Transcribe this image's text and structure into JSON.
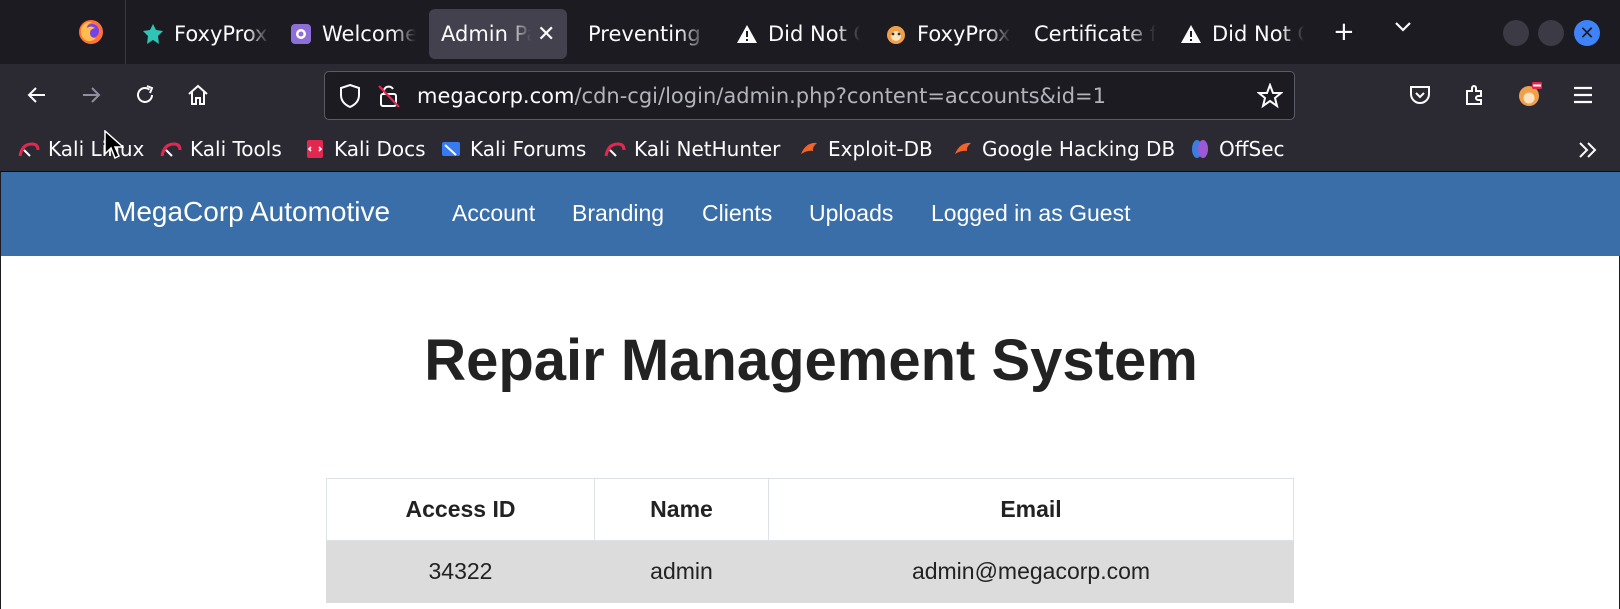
{
  "browser": {
    "tabs": [
      {
        "label": "FoxyProxy",
        "icon": "foxyproxy-icon",
        "active": false
      },
      {
        "label": "Welcome",
        "icon": "tor-icon",
        "active": false
      },
      {
        "label": "Admin Panel",
        "icon": "",
        "active": true
      },
      {
        "label": "Preventing V",
        "icon": "",
        "active": false
      },
      {
        "label": "Did Not Connect",
        "icon": "warning-icon",
        "active": false
      },
      {
        "label": "FoxyProxy",
        "icon": "foxyproxy-cat-icon",
        "active": false
      },
      {
        "label": "Certificate f",
        "icon": "",
        "active": false
      },
      {
        "label": "Did Not Connect",
        "icon": "warning-icon",
        "active": false
      }
    ],
    "new_tab_symbol": "+",
    "list_tabs_symbol": "⌵",
    "url": {
      "host": "megacorp.com",
      "path": "/cdn-cgi/login/admin.php?content=accounts&id=1"
    },
    "bookmarks": [
      {
        "label": "Kali Linux",
        "icon": "kali-icon"
      },
      {
        "label": "Kali Tools",
        "icon": "kali-icon"
      },
      {
        "label": "Kali Docs",
        "icon": "kali-docs-icon"
      },
      {
        "label": "Kali Forums",
        "icon": "kali-forums-icon"
      },
      {
        "label": "Kali NetHunter",
        "icon": "kali-icon"
      },
      {
        "label": "Exploit-DB",
        "icon": "exploitdb-icon"
      },
      {
        "label": "Google Hacking DB",
        "icon": "exploitdb-icon"
      },
      {
        "label": "OffSec",
        "icon": "offsec-icon"
      }
    ],
    "colors": {
      "tabstrip_bg": "#1c1b22",
      "toolbar_bg": "#2b2a33",
      "accent_close": "#3f83f8"
    }
  },
  "site": {
    "brand": "MegaCorp Automotive",
    "nav": [
      "Account",
      "Branding",
      "Clients",
      "Uploads",
      "Logged in as Guest"
    ],
    "title": "Repair Management System",
    "table": {
      "headers": [
        "Access ID",
        "Name",
        "Email"
      ],
      "rows": [
        [
          "34322",
          "admin",
          "admin@megacorp.com"
        ]
      ]
    },
    "colors": {
      "navbar_bg": "#3a6ea8",
      "row_bg": "#dcdcdc"
    }
  }
}
